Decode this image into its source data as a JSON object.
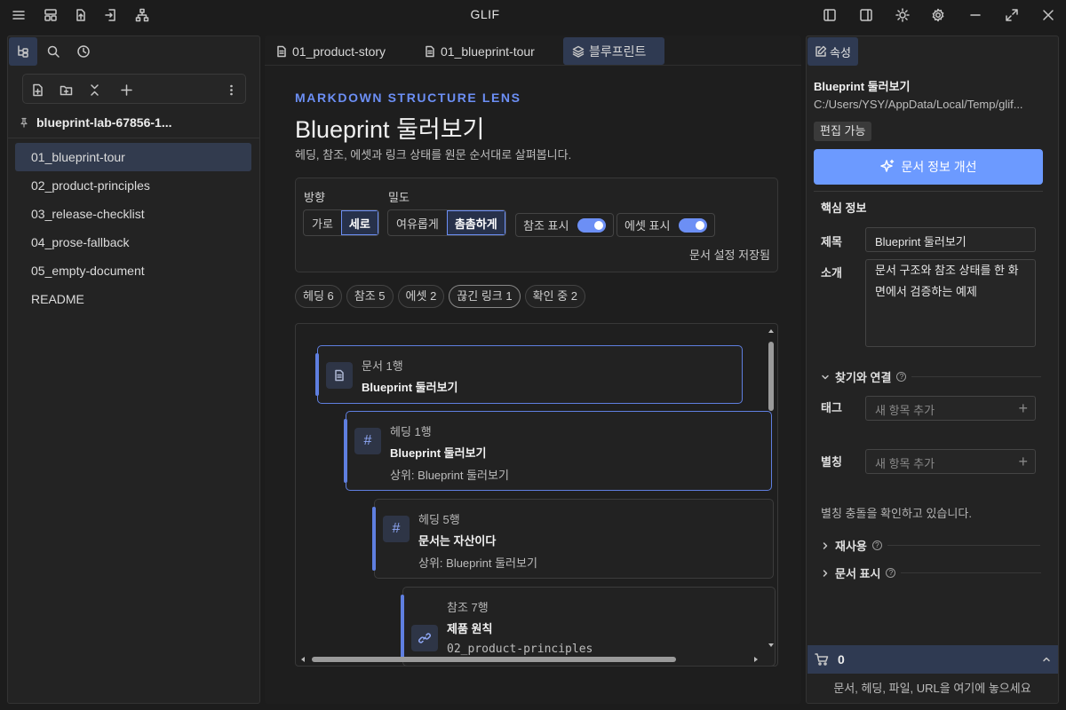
{
  "app": {
    "title": "GLIF"
  },
  "left": {
    "vault_name": "blueprint-lab-67856-1...",
    "files": [
      "01_blueprint-tour",
      "02_product-principles",
      "03_release-checklist",
      "04_prose-fallback",
      "05_empty-document",
      "README"
    ],
    "active_index": 0
  },
  "center": {
    "tabs": [
      "01_product-story",
      "01_blueprint-tour",
      "블루프린트"
    ],
    "lens_label": "MARKDOWN STRUCTURE LENS",
    "doc_title": "Blueprint 둘러보기",
    "doc_desc": "헤딩, 참조, 에셋과 링크 상태를 원문 순서대로 살펴봅니다.",
    "settings": {
      "direction_label": "방향",
      "direction_options": [
        "가로",
        "세로"
      ],
      "direction_selected": 1,
      "density_label": "밀도",
      "density_options": [
        "여유롭게",
        "촘촘하게"
      ],
      "density_selected": 1,
      "toggle_refs": "참조 표시",
      "toggle_assets": "에셋 표시",
      "save_status": "문서 설정 저장됨"
    },
    "chips": [
      "헤딩 6",
      "참조 5",
      "에셋 2",
      "끊긴 링크 1",
      "확인 중 2"
    ],
    "nodes": [
      {
        "kind": "문서  1행",
        "title": "Blueprint 둘러보기",
        "sub": ""
      },
      {
        "kind": "헤딩  1행",
        "title": "Blueprint 둘러보기",
        "sub": "상위: Blueprint 둘러보기"
      },
      {
        "kind": "헤딩  5행",
        "title": "문서는 자산이다",
        "sub": "상위: Blueprint 둘러보기"
      },
      {
        "kind": "참조  7행",
        "title": "제품 원칙",
        "sub": "02_product-principles"
      }
    ]
  },
  "right": {
    "tab_label": "속성",
    "title": "Blueprint 둘러보기",
    "path": "C:/Users/YSY/AppData/Local/Temp/glif...",
    "badge": "편집 가능",
    "improve_button": "문서 정보 개선",
    "core_title": "핵심 정보",
    "field_title_label": "제목",
    "field_title_value": "Blueprint 둘러보기",
    "field_intro_label": "소개",
    "field_intro_value": "문서 구조와 참조 상태를 한 화면에서 검증하는 예제",
    "find_link": "찾기와 연결",
    "tag_label": "태그",
    "tag_placeholder": "새 항목 추가",
    "alias_label": "별칭",
    "alias_placeholder": "새 항목 추가",
    "alias_msg": "별칭 충돌을 확인하고 있습니다.",
    "reuse": "재사용",
    "doc_display": "문서 표시",
    "cart_count": "0",
    "drop_hint": "문서, 헤딩, 파일, URL을 여기에 놓으세요"
  }
}
